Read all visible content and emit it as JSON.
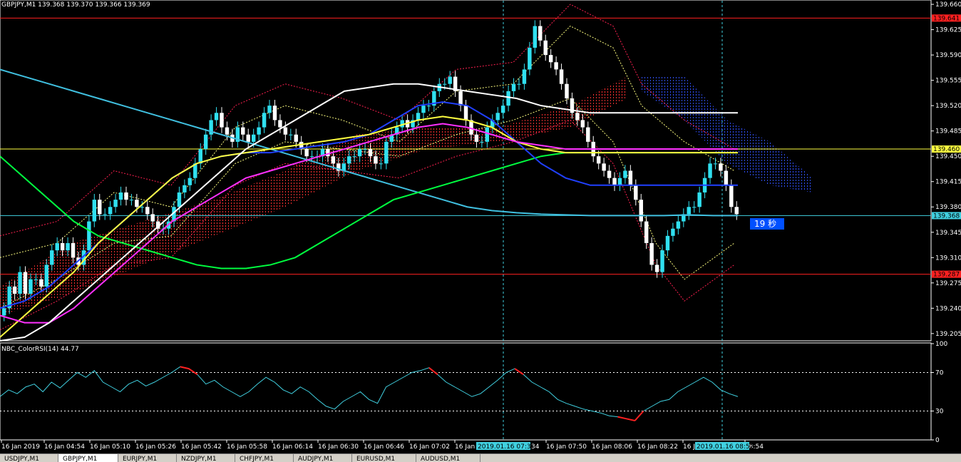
{
  "chart_data": [
    {
      "type": "candlestick",
      "title": "GBPJPY,M1  139.368 139.370 139.366 139.369",
      "ylim": [
        139.195,
        139.665
      ],
      "y_ticks": [
        "139.660",
        "139.625",
        "139.590",
        "139.555",
        "139.520",
        "139.485",
        "139.450",
        "139.415",
        "139.380",
        "139.345",
        "139.310",
        "139.275",
        "139.240",
        "139.205"
      ],
      "x_ticks": [
        "16 Jan 2019",
        "16 Jan 04:54",
        "16 Jan 05:10",
        "16 Jan 05:26",
        "16 Jan 05:42",
        "16 Jan 05:58",
        "16 Jan 06:14",
        "16 Jan 06:30",
        "16 Jan 06:46",
        "16 Jan 07:02",
        "16 Jan",
        "16 Jan 07:50",
        "16 Jan 08:06",
        "16 Jan 08:22",
        "16 J",
        "08:54"
      ],
      "crosshair_times": [
        "2019.01.16 07:35",
        "2019.01.16 08:52"
      ],
      "crosshair_suffix": "34",
      "hlines": [
        {
          "value": 139.641,
          "label": "139.641",
          "color": "#ff2020"
        },
        {
          "value": 139.46,
          "label": "139.460",
          "color": "#ffff40"
        },
        {
          "value": 139.368,
          "label": "139.368",
          "color": "#40d0e0"
        },
        {
          "value": 139.287,
          "label": "139.287",
          "color": "#ff2020"
        }
      ],
      "timer_label": "19 秒",
      "series": [
        {
          "kind": "candles",
          "close": [
            139.24,
            139.27,
            139.26,
            139.29,
            139.26,
            139.28,
            139.28,
            139.27,
            139.3,
            139.32,
            139.33,
            139.32,
            139.33,
            139.31,
            139.3,
            139.32,
            139.36,
            139.39,
            139.37,
            139.37,
            139.38,
            139.39,
            139.4,
            139.39,
            139.39,
            139.38,
            139.38,
            139.37,
            139.36,
            139.35,
            139.35,
            139.36,
            139.38,
            139.4,
            139.41,
            139.42,
            139.44,
            139.46,
            139.48,
            139.5,
            139.51,
            139.49,
            139.48,
            139.47,
            139.49,
            139.48,
            139.47,
            139.48,
            139.49,
            139.51,
            139.52,
            139.5,
            139.49,
            139.48,
            139.48,
            139.47,
            139.46,
            139.45,
            139.45,
            139.45,
            139.46,
            139.45,
            139.44,
            139.43,
            139.44,
            139.45,
            139.45,
            139.46,
            139.46,
            139.45,
            139.44,
            139.44,
            139.47,
            139.48,
            139.49,
            139.5,
            139.49,
            139.5,
            139.51,
            139.52,
            139.52,
            139.54,
            139.55,
            139.55,
            139.56,
            139.54,
            139.52,
            139.5,
            139.48,
            139.47,
            139.47,
            139.49,
            139.5,
            139.51,
            139.52,
            139.54,
            139.55,
            139.55,
            139.57,
            139.6,
            139.63,
            139.61,
            139.59,
            139.58,
            139.57,
            139.55,
            139.53,
            139.51,
            139.5,
            139.49,
            139.47,
            139.45,
            139.44,
            139.43,
            139.42,
            139.41,
            139.42,
            139.43,
            139.41,
            139.39,
            139.36,
            139.33,
            139.3,
            139.29,
            139.32,
            139.34,
            139.35,
            139.36,
            139.37,
            139.38,
            139.38,
            139.4,
            139.42,
            139.44,
            139.44,
            139.43,
            139.41,
            139.38,
            139.37
          ]
        },
        {
          "kind": "line",
          "name": "",
          "color": "#40c0e0",
          "values": [
            139.57,
            139.56,
            139.55,
            139.54,
            139.53,
            139.52,
            139.51,
            139.5,
            139.49,
            139.48,
            139.47,
            139.46,
            139.45,
            139.44,
            139.43,
            139.42,
            139.41,
            139.4,
            139.39,
            139.38,
            139.375,
            139.372,
            139.37,
            139.369,
            139.368,
            139.368,
            139.368,
            139.368,
            139.369,
            139.368,
            139.368
          ]
        },
        {
          "kind": "line",
          "name": "",
          "color": "#00ff40",
          "values": [
            139.45,
            139.42,
            139.39,
            139.36,
            139.34,
            139.33,
            139.32,
            139.31,
            139.3,
            139.295,
            139.295,
            139.3,
            139.31,
            139.33,
            139.35,
            139.37,
            139.39,
            139.4,
            139.41,
            139.42,
            139.43,
            139.44,
            139.45,
            139.455,
            139.455,
            139.455,
            139.455,
            139.455,
            139.455,
            139.455,
            139.455
          ]
        },
        {
          "kind": "line",
          "name": "",
          "color": "#2040ff",
          "values": [
            139.24,
            139.25,
            139.27,
            139.3,
            139.33,
            139.36,
            139.39,
            139.42,
            139.44,
            139.45,
            139.455,
            139.455,
            139.46,
            139.465,
            139.47,
            139.48,
            139.5,
            139.52,
            139.525,
            139.52,
            139.5,
            139.47,
            139.44,
            139.42,
            139.41,
            139.41,
            139.41,
            139.41,
            139.41,
            139.41,
            139.41
          ]
        },
        {
          "kind": "line",
          "name": "",
          "color": "#ffff40",
          "values": [
            139.2,
            139.23,
            139.26,
            139.29,
            139.33,
            139.36,
            139.39,
            139.42,
            139.44,
            139.45,
            139.455,
            139.46,
            139.465,
            139.47,
            139.475,
            139.48,
            139.49,
            139.5,
            139.505,
            139.5,
            139.49,
            139.47,
            139.46,
            139.455,
            139.455,
            139.455,
            139.455,
            139.455,
            139.455,
            139.455,
            139.455
          ]
        },
        {
          "kind": "line",
          "name": "",
          "color": "#ff30ff",
          "values": [
            139.23,
            139.22,
            139.22,
            139.24,
            139.27,
            139.3,
            139.33,
            139.36,
            139.38,
            139.4,
            139.42,
            139.43,
            139.44,
            139.45,
            139.46,
            139.47,
            139.48,
            139.49,
            139.495,
            139.49,
            139.48,
            139.47,
            139.465,
            139.46,
            139.46,
            139.46,
            139.46,
            139.46,
            139.46,
            139.46,
            139.46
          ]
        },
        {
          "kind": "line",
          "name": "",
          "color": "#ffffff",
          "values": [
            139.195,
            139.2,
            139.22,
            139.25,
            139.28,
            139.31,
            139.34,
            139.37,
            139.4,
            139.43,
            139.46,
            139.48,
            139.5,
            139.52,
            139.54,
            139.545,
            139.55,
            139.55,
            139.545,
            139.54,
            139.535,
            139.53,
            139.52,
            139.515,
            139.51,
            139.51,
            139.51,
            139.51,
            139.51,
            139.51,
            139.51
          ]
        }
      ]
    },
    {
      "type": "line",
      "title": "NBC_ColorRSI(14) 44.77",
      "ylim": [
        0,
        100
      ],
      "y_ticks": [
        "100",
        "70",
        "30",
        "0"
      ],
      "levels": [
        70,
        30
      ],
      "series": [
        {
          "name": "",
          "color": "#40d0e0",
          "values": [
            45,
            52,
            48,
            55,
            58,
            50,
            60,
            54,
            62,
            70,
            65,
            72,
            60,
            55,
            50,
            58,
            62,
            56,
            60,
            65,
            70,
            76,
            74,
            68,
            58,
            62,
            55,
            50,
            45,
            50,
            58,
            65,
            60,
            52,
            48,
            55,
            50,
            42,
            35,
            32,
            40,
            45,
            50,
            42,
            38,
            55,
            60,
            65,
            70,
            72,
            75,
            68,
            60,
            55,
            50,
            45,
            48,
            55,
            62,
            70,
            74,
            68,
            60,
            55,
            50,
            42,
            38,
            35,
            32,
            30,
            28,
            25,
            24,
            22,
            20,
            30,
            35,
            40,
            42,
            50,
            55,
            60,
            65,
            60,
            52,
            48,
            45
          ]
        }
      ]
    }
  ],
  "tabs": [
    "USDJPY,M1",
    "GBPJPY,M1",
    "EURJPY,M1",
    "NZDJPY,M1",
    "CHFJPY,M1",
    "AUDJPY,M1",
    "EURUSD,M1",
    "AUDUSD,M1"
  ],
  "active_tab": 1,
  "colors": {
    "background": "#000000",
    "grid": "#ffffff",
    "bull_candle": "#30e0f0",
    "bear_candle": "#ffffff",
    "cloud_red": "#ff3030",
    "cloud_blue": "#3050ff",
    "bollinger_red": "#ff2050",
    "bollinger_yellow": "#ffff80",
    "timer_bg": "#0050ff"
  }
}
